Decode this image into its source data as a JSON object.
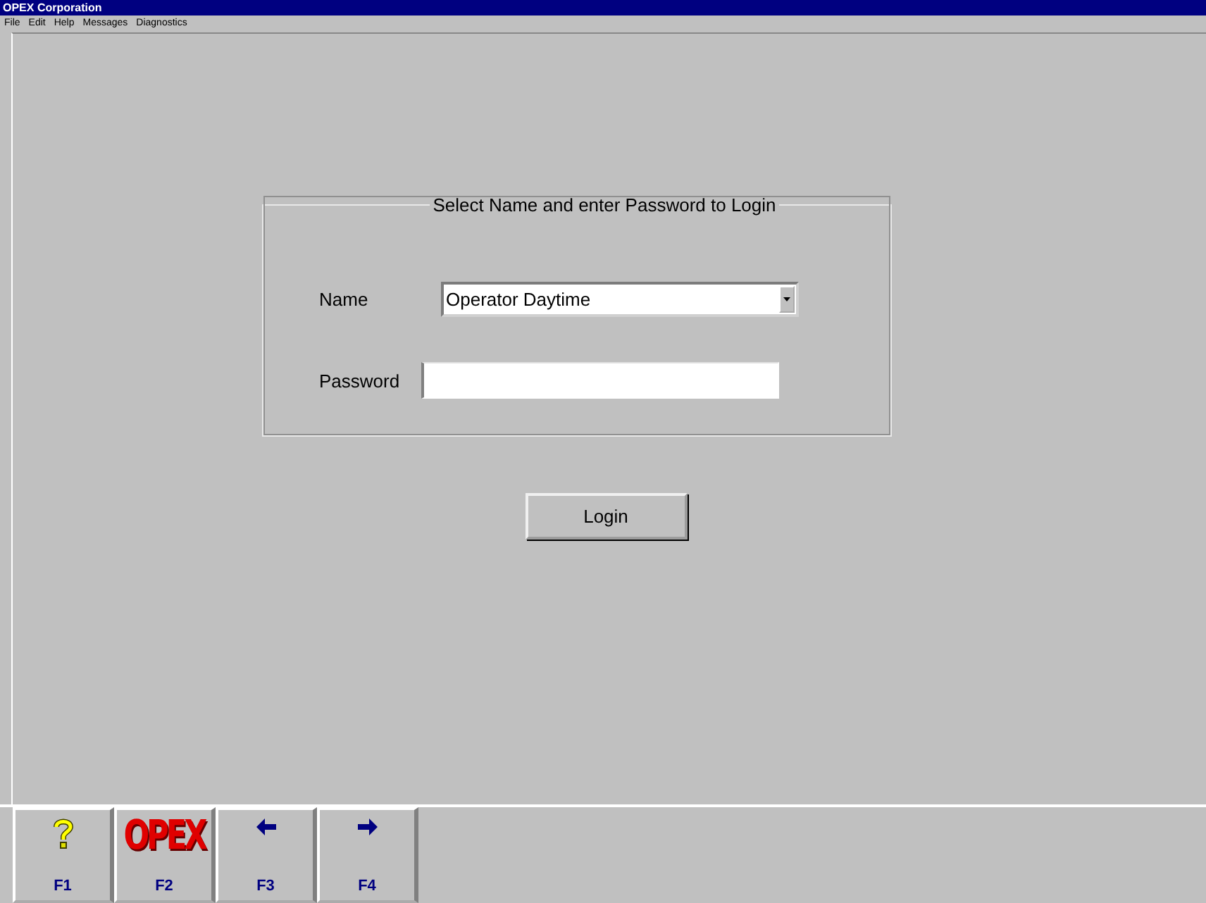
{
  "window": {
    "title": "OPEX Corporation"
  },
  "menu": [
    "File",
    "Edit",
    "Help",
    "Messages",
    "Diagnostics"
  ],
  "login": {
    "title": "Select Name and enter Password to Login",
    "name_label": "Name",
    "name_value": "Operator Daytime",
    "password_label": "Password",
    "button": "Login"
  },
  "function_keys": [
    {
      "key": "F1",
      "kind": "help"
    },
    {
      "key": "F2",
      "kind": "logo",
      "text": "OPEX"
    },
    {
      "key": "F3",
      "kind": "left"
    },
    {
      "key": "F4",
      "kind": "right"
    }
  ]
}
